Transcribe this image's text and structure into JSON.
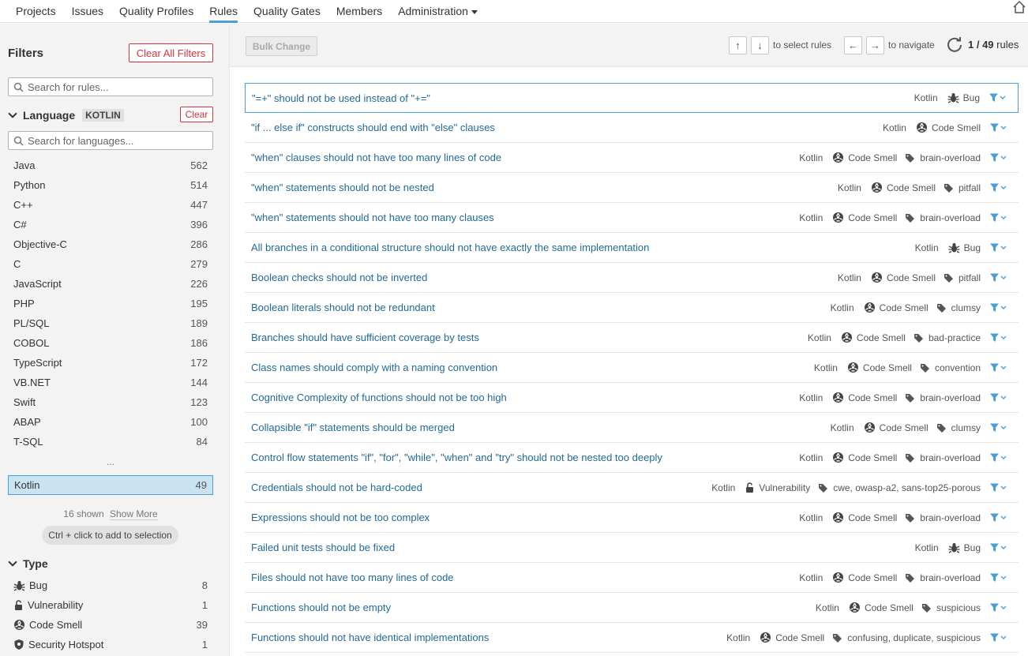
{
  "nav": {
    "items": [
      "Projects",
      "Issues",
      "Quality Profiles",
      "Rules",
      "Quality Gates",
      "Members",
      "Administration"
    ],
    "active_index": 3
  },
  "sidebar": {
    "title": "Filters",
    "clear_all_label": "Clear All Filters",
    "search_placeholder": "Search for rules...",
    "language": {
      "header": "Language",
      "badge": "KOTLIN",
      "clear_label": "Clear",
      "search_placeholder": "Search for languages...",
      "items": [
        {
          "name": "Java",
          "count": "562"
        },
        {
          "name": "Python",
          "count": "514"
        },
        {
          "name": "C++",
          "count": "447"
        },
        {
          "name": "C#",
          "count": "396"
        },
        {
          "name": "Objective-C",
          "count": "286"
        },
        {
          "name": "C",
          "count": "279"
        },
        {
          "name": "JavaScript",
          "count": "226"
        },
        {
          "name": "PHP",
          "count": "195"
        },
        {
          "name": "PL/SQL",
          "count": "189"
        },
        {
          "name": "COBOL",
          "count": "186"
        },
        {
          "name": "TypeScript",
          "count": "172"
        },
        {
          "name": "VB.NET",
          "count": "144"
        },
        {
          "name": "Swift",
          "count": "123"
        },
        {
          "name": "ABAP",
          "count": "100"
        },
        {
          "name": "T-SQL",
          "count": "84"
        }
      ],
      "ellipsis": "...",
      "selected": {
        "name": "Kotlin",
        "count": "49"
      },
      "shown_text": "16 shown",
      "show_more": "Show More",
      "ctrl_hint": "Ctrl + click to add to selection"
    },
    "type": {
      "header": "Type",
      "items": [
        {
          "name": "Bug",
          "count": "8",
          "icon": "bug-icon"
        },
        {
          "name": "Vulnerability",
          "count": "1",
          "icon": "lock-icon"
        },
        {
          "name": "Code Smell",
          "count": "39",
          "icon": "code-smell-icon"
        },
        {
          "name": "Security Hotspot",
          "count": "1",
          "icon": "shield-icon"
        }
      ]
    }
  },
  "toolbar": {
    "bulk_change": "Bulk Change",
    "up_key": "↑",
    "down_key": "↓",
    "select_text": "to select rules",
    "left_key": "←",
    "right_key": "→",
    "navigate_text": "to navigate",
    "paging_current": "1 / 49",
    "paging_label": "rules"
  },
  "rules": [
    {
      "title": "\"=+\" should not be used instead of \"+=\"",
      "lang": "Kotlin",
      "type": "Bug",
      "tags": ""
    },
    {
      "title": "\"if ... else if\" constructs should end with \"else\" clauses",
      "lang": "Kotlin",
      "type": "Code Smell",
      "tags": ""
    },
    {
      "title": "\"when\" clauses should not have too many lines of code",
      "lang": "Kotlin",
      "type": "Code Smell",
      "tags": "brain-overload"
    },
    {
      "title": "\"when\" statements should not be nested",
      "lang": "Kotlin",
      "type": "Code Smell",
      "tags": "pitfall"
    },
    {
      "title": "\"when\" statements should not have too many clauses",
      "lang": "Kotlin",
      "type": "Code Smell",
      "tags": "brain-overload"
    },
    {
      "title": "All branches in a conditional structure should not have exactly the same implementation",
      "lang": "Kotlin",
      "type": "Bug",
      "tags": ""
    },
    {
      "title": "Boolean checks should not be inverted",
      "lang": "Kotlin",
      "type": "Code Smell",
      "tags": "pitfall"
    },
    {
      "title": "Boolean literals should not be redundant",
      "lang": "Kotlin",
      "type": "Code Smell",
      "tags": "clumsy"
    },
    {
      "title": "Branches should have sufficient coverage by tests",
      "lang": "Kotlin",
      "type": "Code Smell",
      "tags": "bad-practice"
    },
    {
      "title": "Class names should comply with a naming convention",
      "lang": "Kotlin",
      "type": "Code Smell",
      "tags": "convention"
    },
    {
      "title": "Cognitive Complexity of functions should not be too high",
      "lang": "Kotlin",
      "type": "Code Smell",
      "tags": "brain-overload"
    },
    {
      "title": "Collapsible \"if\" statements should be merged",
      "lang": "Kotlin",
      "type": "Code Smell",
      "tags": "clumsy"
    },
    {
      "title": "Control flow statements \"if\", \"for\", \"while\", \"when\" and \"try\" should not be nested too deeply",
      "lang": "Kotlin",
      "type": "Code Smell",
      "tags": "brain-overload"
    },
    {
      "title": "Credentials should not be hard-coded",
      "lang": "Kotlin",
      "type": "Vulnerability",
      "tags": "cwe, owasp-a2, sans-top25-porous"
    },
    {
      "title": "Expressions should not be too complex",
      "lang": "Kotlin",
      "type": "Code Smell",
      "tags": "brain-overload"
    },
    {
      "title": "Failed unit tests should be fixed",
      "lang": "Kotlin",
      "type": "Bug",
      "tags": ""
    },
    {
      "title": "Files should not have too many lines of code",
      "lang": "Kotlin",
      "type": "Code Smell",
      "tags": "brain-overload"
    },
    {
      "title": "Functions should not be empty",
      "lang": "Kotlin",
      "type": "Code Smell",
      "tags": "suspicious"
    },
    {
      "title": "Functions should not have identical implementations",
      "lang": "Kotlin",
      "type": "Code Smell",
      "tags": "confusing, duplicate, suspicious"
    }
  ],
  "colors": {
    "accent": "#4b9fd5",
    "link": "#236a97",
    "danger": "#d4333f",
    "sidebar_bg": "#f3f3f3"
  }
}
